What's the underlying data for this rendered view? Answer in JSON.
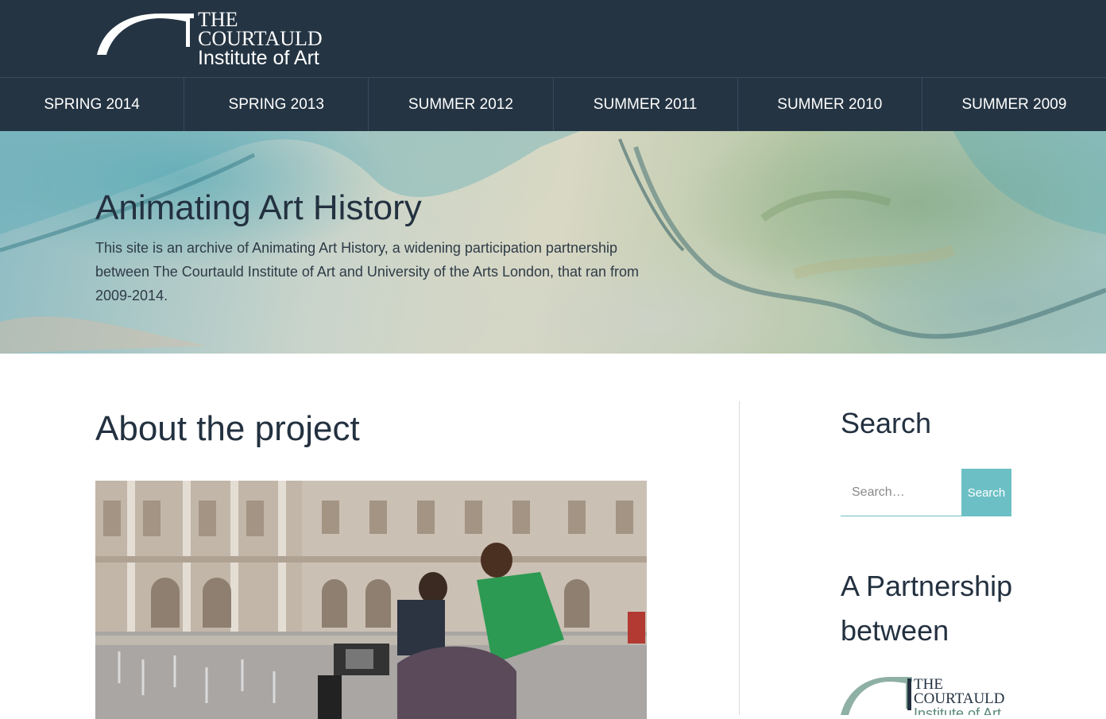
{
  "header": {
    "logo": {
      "line1": "THE",
      "line2": "COURTAULD",
      "line3": "Institute of Art"
    }
  },
  "nav": {
    "items": [
      {
        "label": "SPRING 2014"
      },
      {
        "label": "SPRING 2013"
      },
      {
        "label": "SUMMER 2012"
      },
      {
        "label": "SUMMER 2011"
      },
      {
        "label": "SUMMER 2010"
      },
      {
        "label": "SUMMER 2009"
      }
    ]
  },
  "hero": {
    "title": "Animating Art History",
    "description": "This site is an archive of Animating Art History, a widening participation partnership between The Courtauld Institute of Art and University of the Arts London, that ran from 2009-2014."
  },
  "main": {
    "title": "About the project"
  },
  "sidebar": {
    "search": {
      "title": "Search",
      "placeholder": "Search…",
      "button_label": "Search"
    },
    "partnership": {
      "title": "A Partnership between",
      "logo": {
        "line1": "THE",
        "line2": "COURTAULD",
        "line3": "Institute of Art"
      }
    }
  },
  "colors": {
    "header_bg": "#243443",
    "accent": "#6cc0c5",
    "text": "#233140"
  }
}
